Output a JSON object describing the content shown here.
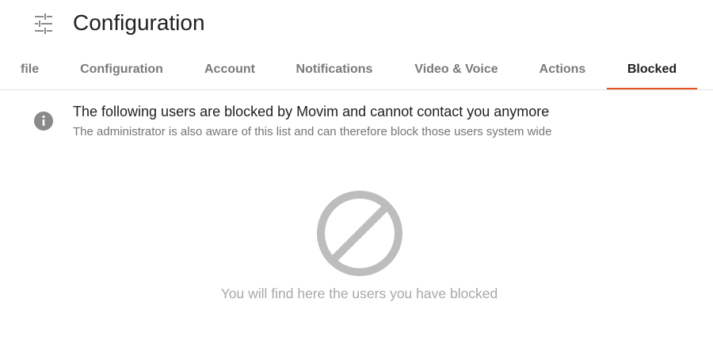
{
  "header": {
    "title": "Configuration",
    "menu_icon": "tune-icon"
  },
  "tabs": [
    {
      "label": "file",
      "active": false
    },
    {
      "label": "Configuration",
      "active": false
    },
    {
      "label": "Account",
      "active": false
    },
    {
      "label": "Notifications",
      "active": false
    },
    {
      "label": "Video & Voice",
      "active": false
    },
    {
      "label": "Actions",
      "active": false
    },
    {
      "label": "Blocked",
      "active": true
    }
  ],
  "info": {
    "icon": "info-icon",
    "title": "The following users are blocked by Movim and cannot contact you anymore",
    "subtitle": "The administrator is also aware of this list and can therefore block those users system wide"
  },
  "empty_state": {
    "icon": "block-icon",
    "text": "You will find here the users you have blocked"
  },
  "colors": {
    "accent": "#e5501e",
    "tab_inactive": "#7a7a7a",
    "empty_icon": "#bdbdbd"
  }
}
